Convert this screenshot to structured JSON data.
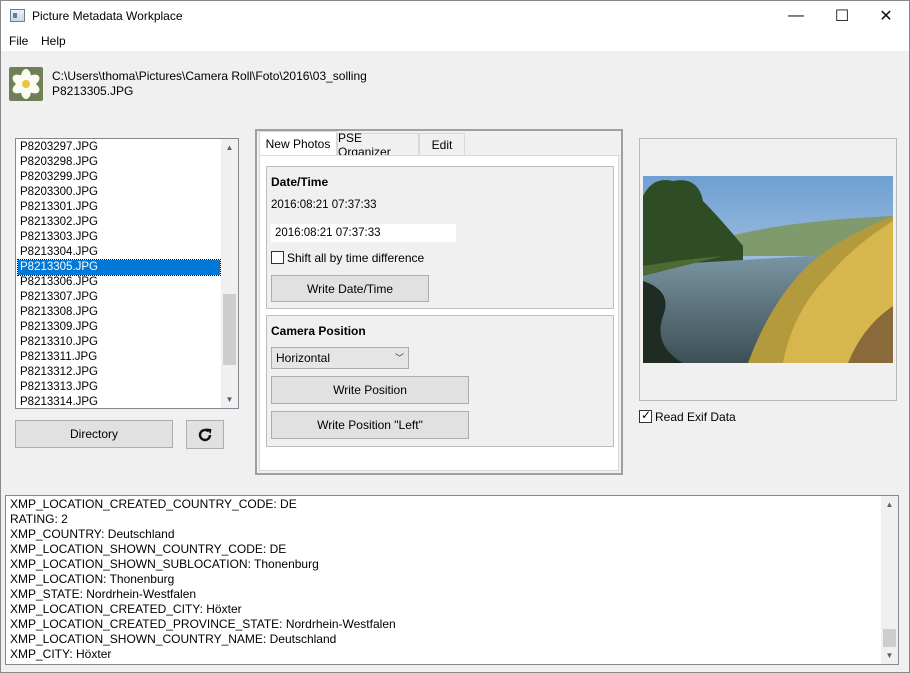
{
  "window": {
    "title": "Picture Metadata Workplace",
    "controls": {
      "minimize": "—",
      "maximize": "☐",
      "close": "✕"
    }
  },
  "menu": {
    "file": "File",
    "help": "Help"
  },
  "current": {
    "directory": "C:\\Users\\thoma\\Pictures\\Camera Roll\\Foto\\2016\\03_solling",
    "filename": "P8213305.JPG"
  },
  "file_list": {
    "items": [
      "P8203297.JPG",
      "P8203298.JPG",
      "P8203299.JPG",
      "P8203300.JPG",
      "P8213301.JPG",
      "P8213302.JPG",
      "P8213303.JPG",
      "P8213304.JPG",
      "P8213305.JPG",
      "P8213306.JPG",
      "P8213307.JPG",
      "P8213308.JPG",
      "P8213309.JPG",
      "P8213310.JPG",
      "P8213311.JPG",
      "P8213312.JPG",
      "P8213313.JPG",
      "P8213314.JPG"
    ],
    "selected_index": 8
  },
  "buttons": {
    "directory": "Directory",
    "refresh_icon": "refresh-icon"
  },
  "tabs": [
    "New Photos",
    "PSE Organizer",
    "Edit"
  ],
  "datetime_group": {
    "title": "Date/Time",
    "current_value": "2016:08:21 07:37:33",
    "input_value": "2016:08:21 07:37:33",
    "shift_label": "Shift all by time difference",
    "write_button": "Write Date/Time"
  },
  "camera_group": {
    "title": "Camera Position",
    "selected_position": "Horizontal",
    "write_position_button": "Write Position",
    "write_left_button": "Write Position \"Left\""
  },
  "preview": {
    "read_exif_label": "Read Exif Data",
    "read_exif_checked": true
  },
  "metadata_lines": [
    "XMP_LOCATION_CREATED_COUNTRY_CODE: DE",
    "RATING: 2",
    "XMP_COUNTRY: Deutschland",
    "XMP_LOCATION_SHOWN_COUNTRY_CODE: DE",
    "XMP_LOCATION_SHOWN_SUBLOCATION: Thonenburg",
    "XMP_LOCATION: Thonenburg",
    "XMP_STATE: Nordrhein-Westfalen",
    "XMP_LOCATION_CREATED_CITY: Höxter",
    "XMP_LOCATION_CREATED_PROVINCE_STATE: Nordrhein-Westfalen",
    "XMP_LOCATION_SHOWN_COUNTRY_NAME: Deutschland",
    "XMP_CITY: Höxter"
  ],
  "colors": {
    "selection": "#0078d7",
    "window_bg": "#f0f0f0"
  }
}
